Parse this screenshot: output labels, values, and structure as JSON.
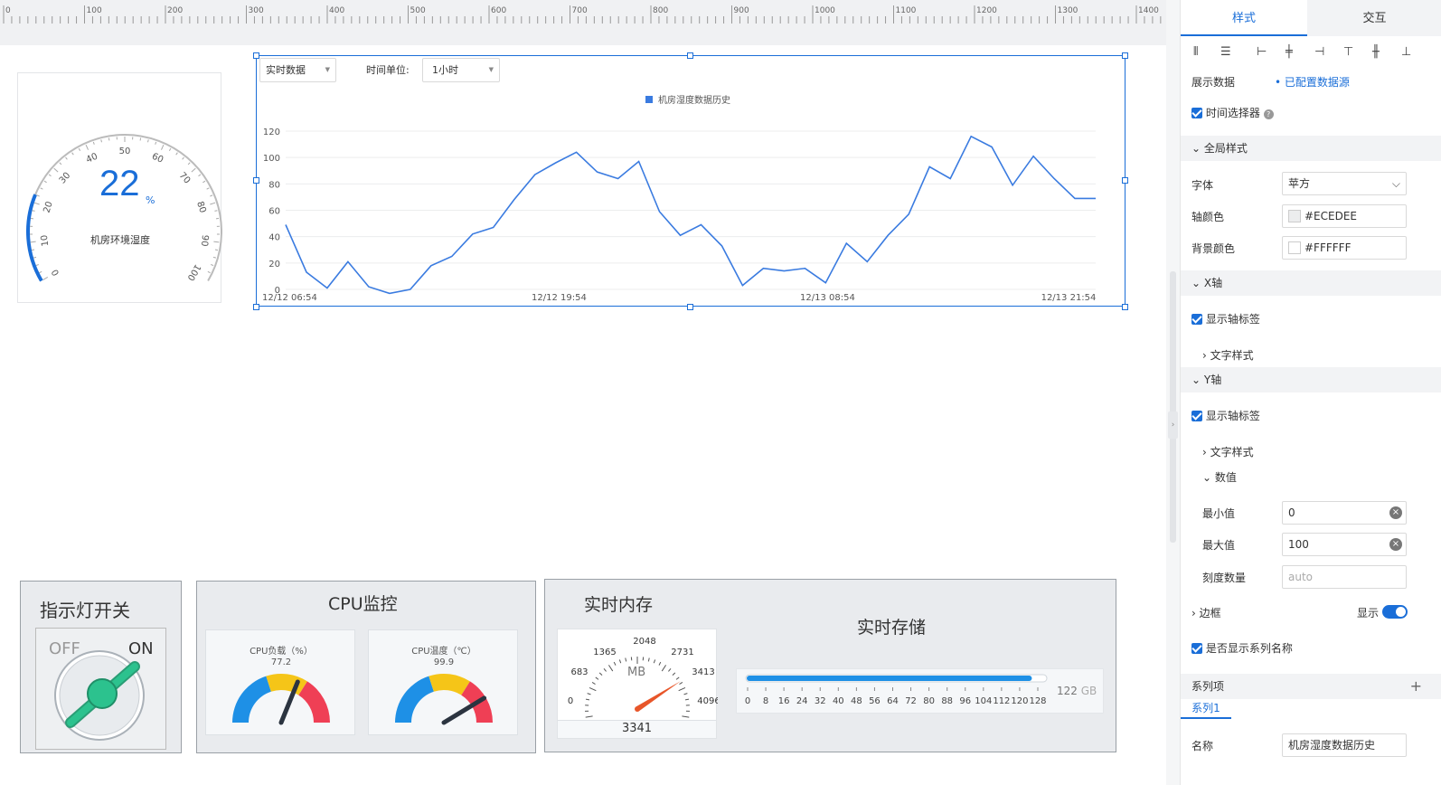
{
  "ruler": {
    "ticks": [
      "0",
      "100",
      "200",
      "300",
      "400",
      "500",
      "600",
      "700",
      "800",
      "900",
      "1000",
      "1100",
      "1200",
      "1300",
      "1400"
    ]
  },
  "gauge_widget": {
    "value": "22",
    "unit": "%",
    "label": "机房环境湿度",
    "ticks": [
      "0",
      "10",
      "20",
      "30",
      "40",
      "50",
      "60",
      "70",
      "80",
      "90",
      "100"
    ],
    "fraction": 0.22,
    "color": "#1a6ed8"
  },
  "chart_widget": {
    "mode_select": "实时数据",
    "time_unit_label": "时间单位:",
    "time_unit_value": "1小时",
    "legend": "机房湿度数据历史",
    "x_ticks": [
      "12/12 06:54",
      "12/12 19:54",
      "12/13 08:54",
      "12/13 21:54"
    ],
    "y_ticks": [
      "0",
      "20",
      "40",
      "60",
      "80",
      "100",
      "120"
    ]
  },
  "chart_data": {
    "type": "line",
    "title": "",
    "series": [
      {
        "name": "机房湿度数据历史",
        "values": [
          49,
          13,
          1,
          21,
          2,
          -3,
          0,
          18,
          25,
          42,
          47,
          68,
          87,
          96,
          104,
          89,
          84,
          97,
          59,
          41,
          49,
          33,
          3,
          16,
          14,
          16,
          5,
          35,
          21,
          41,
          57,
          93,
          84,
          116,
          108,
          79,
          101,
          84,
          69,
          69
        ]
      }
    ],
    "x_labels": [
      "12/12 06:54",
      "12/12 19:54",
      "12/13 08:54",
      "12/13 21:54"
    ],
    "ylim": [
      0,
      120
    ],
    "grid": true,
    "legend_position": "top-center",
    "color": "#3a7be0"
  },
  "light_switch": {
    "title": "指示灯开关",
    "off": "OFF",
    "on": "ON"
  },
  "cpu": {
    "title": "CPU监控",
    "load": {
      "label": "CPU负载（%）",
      "value": "77.2",
      "fraction": 0.772
    },
    "temp": {
      "label": "CPU温度（℃）",
      "value": "99.9",
      "fraction": 0.999
    },
    "colors": [
      "#1e90e6",
      "#f5c518",
      "#ef3f55"
    ]
  },
  "memory": {
    "title": "实时内存",
    "unit": "MB",
    "value": "3341",
    "ticks": [
      "0",
      "683",
      "1365",
      "2048",
      "2731",
      "3413",
      "4096"
    ],
    "fraction": 0.8157
  },
  "storage": {
    "title": "实时存储",
    "value": "122",
    "unit": "GB",
    "fraction": 0.953,
    "ticks": [
      "0",
      "8",
      "16",
      "24",
      "32",
      "40",
      "48",
      "56",
      "64",
      "72",
      "80",
      "88",
      "96",
      "104",
      "112",
      "120",
      "128"
    ]
  },
  "panel": {
    "tabs": [
      "样式",
      "交互"
    ],
    "show_data_label": "展示数据",
    "data_source": "已配置数据源",
    "time_selector": "时间选择器",
    "global_style": "全局样式",
    "font_label": "字体",
    "font_value": "苹方",
    "axis_color_label": "轴颜色",
    "axis_color_value": "#ECEDEE",
    "bg_color_label": "背景颜色",
    "bg_color_value": "#FFFFFF",
    "x_axis": "X轴",
    "show_axis_label_x": "显示轴标签",
    "text_style_x": "文字样式",
    "y_axis": "Y轴",
    "show_axis_label_y": "显示轴标签",
    "text_style_y": "文字样式",
    "values": "数值",
    "min_label": "最小值",
    "min_value": "0",
    "max_label": "最大值",
    "max_value": "100",
    "tick_count_label": "刻度数量",
    "tick_count_placeholder": "auto",
    "border_label": "边框",
    "border_show": "显示",
    "show_series_name": "是否显示系列名称",
    "series_items": "系列项",
    "series1": "系列1",
    "name_label": "名称",
    "name_value": "机房湿度数据历史"
  }
}
